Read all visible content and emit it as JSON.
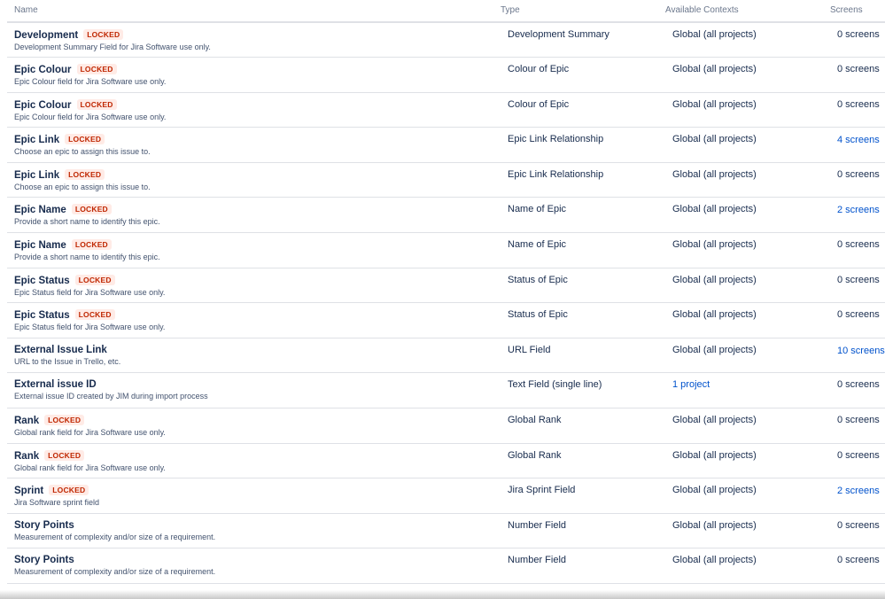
{
  "columns": {
    "name": "Name",
    "type": "Type",
    "contexts": "Available Contexts",
    "screens": "Screens"
  },
  "rows": [
    {
      "name": "Development",
      "locked": "LOCKED",
      "description": "Development Summary Field for Jira Software use only.",
      "type": "Development Summary",
      "context": "Global (all projects)",
      "context_link": false,
      "screens": "0 screens",
      "screens_link": false
    },
    {
      "name": "Epic Colour",
      "locked": "LOCKED",
      "description": "Epic Colour field for Jira Software use only.",
      "type": "Colour of Epic",
      "context": "Global (all projects)",
      "context_link": false,
      "screens": "0 screens",
      "screens_link": false
    },
    {
      "name": "Epic Colour",
      "locked": "LOCKED",
      "description": "Epic Colour field for Jira Software use only.",
      "type": "Colour of Epic",
      "context": "Global (all projects)",
      "context_link": false,
      "screens": "0 screens",
      "screens_link": false
    },
    {
      "name": "Epic Link",
      "locked": "LOCKED",
      "description": "Choose an epic to assign this issue to.",
      "type": "Epic Link Relationship",
      "context": "Global (all projects)",
      "context_link": false,
      "screens": "4 screens",
      "screens_link": true
    },
    {
      "name": "Epic Link",
      "locked": "LOCKED",
      "description": "Choose an epic to assign this issue to.",
      "type": "Epic Link Relationship",
      "context": "Global (all projects)",
      "context_link": false,
      "screens": "0 screens",
      "screens_link": false
    },
    {
      "name": "Epic Name",
      "locked": "LOCKED",
      "description": "Provide a short name to identify this epic.",
      "type": "Name of Epic",
      "context": "Global (all projects)",
      "context_link": false,
      "screens": "2 screens",
      "screens_link": true
    },
    {
      "name": "Epic Name",
      "locked": "LOCKED",
      "description": "Provide a short name to identify this epic.",
      "type": "Name of Epic",
      "context": "Global (all projects)",
      "context_link": false,
      "screens": "0 screens",
      "screens_link": false
    },
    {
      "name": "Epic Status",
      "locked": "LOCKED",
      "description": "Epic Status field for Jira Software use only.",
      "type": "Status of Epic",
      "context": "Global (all projects)",
      "context_link": false,
      "screens": "0 screens",
      "screens_link": false
    },
    {
      "name": "Epic Status",
      "locked": "LOCKED",
      "description": "Epic Status field for Jira Software use only.",
      "type": "Status of Epic",
      "context": "Global (all projects)",
      "context_link": false,
      "screens": "0 screens",
      "screens_link": false
    },
    {
      "name": "External Issue Link",
      "locked": "",
      "description": "URL to the Issue in Trello, etc.",
      "type": "URL Field",
      "context": "Global (all projects)",
      "context_link": false,
      "screens": "10 screens",
      "screens_link": true
    },
    {
      "name": "External issue ID",
      "locked": "",
      "description": "External issue ID created by JIM during import process",
      "type": "Text Field (single line)",
      "context": "1 project",
      "context_link": true,
      "screens": "0 screens",
      "screens_link": false
    },
    {
      "name": "Rank",
      "locked": "LOCKED",
      "description": "Global rank field for Jira Software use only.",
      "type": "Global Rank",
      "context": "Global (all projects)",
      "context_link": false,
      "screens": "0 screens",
      "screens_link": false
    },
    {
      "name": "Rank",
      "locked": "LOCKED",
      "description": "Global rank field for Jira Software use only.",
      "type": "Global Rank",
      "context": "Global (all projects)",
      "context_link": false,
      "screens": "0 screens",
      "screens_link": false
    },
    {
      "name": "Sprint",
      "locked": "LOCKED",
      "description": "Jira Software sprint field",
      "type": "Jira Sprint Field",
      "context": "Global (all projects)",
      "context_link": false,
      "screens": "2 screens",
      "screens_link": true
    },
    {
      "name": "Story Points",
      "locked": "",
      "description": "Measurement of complexity and/or size of a requirement.",
      "type": "Number Field",
      "context": "Global (all projects)",
      "context_link": false,
      "screens": "0 screens",
      "screens_link": false
    },
    {
      "name": "Story Points",
      "locked": "",
      "description": "Measurement of complexity and/or size of a requirement.",
      "type": "Number Field",
      "context": "Global (all projects)",
      "context_link": false,
      "screens": "0 screens",
      "screens_link": false
    }
  ],
  "colors": {
    "link": "#0052cc",
    "locked_text": "#bf2600",
    "locked_bg": "#ffebe6",
    "border": "#dfe1e6"
  }
}
